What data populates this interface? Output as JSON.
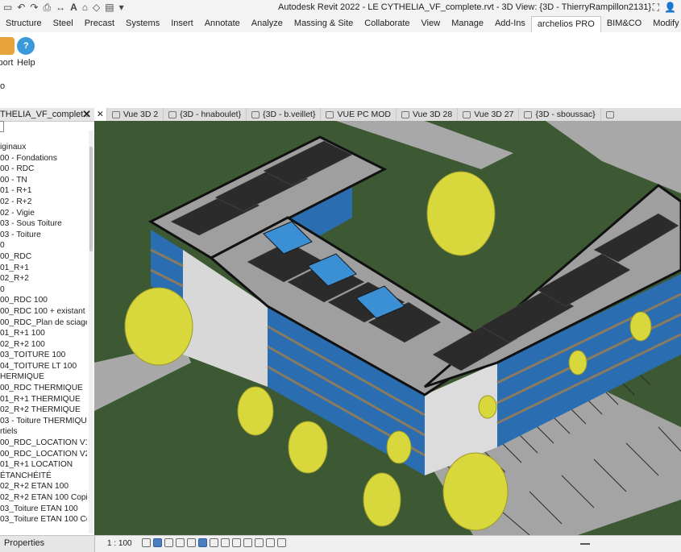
{
  "window": {
    "title": "Autodesk Revit 2022 - LE CYTHELIA_VF_complete.rvt - 3D View: {3D - ThierryRampillon2131}",
    "qat_icons": [
      "open-icon",
      "undo-icon",
      "redo-icon",
      "print-icon",
      "measure-icon",
      "text-icon",
      "3d-icon",
      "section-icon",
      "switch-windows-icon",
      "dropdown-icon"
    ]
  },
  "ribbon_tabs": [
    "Structure",
    "Steel",
    "Precast",
    "Systems",
    "Insert",
    "Annotate",
    "Analyze",
    "Massing & Site",
    "Collaborate",
    "View",
    "Manage",
    "Add-Ins",
    "archelios PRO",
    "BIM&CO",
    "Modify"
  ],
  "active_tab": "archelios PRO",
  "ribbon": {
    "export_label": "port",
    "help_label": "Help",
    "panel_label": "o"
  },
  "browser": {
    "title": "THELIA_VF_complet...",
    "items": [
      "iginaux",
      "00 - Fondations",
      "00 - RDC",
      "00 - TN",
      "01 - R+1",
      "02 - R+2",
      "02 - Vigie",
      "03 - Sous Toiture",
      "03 - Toiture",
      "0",
      "00_RDC",
      "01_R+1",
      "02_R+2",
      "0",
      "00_RDC 100",
      "00_RDC 100 + existant",
      "00_RDC_Plan de sciage",
      "01_R+1 100",
      "02_R+2 100",
      "03_TOITURE 100",
      "04_TOITURE LT 100",
      "HERMIQUE",
      "00_RDC THERMIQUE",
      "01_R+1 THERMIQUE",
      "02_R+2 THERMIQUE",
      "03 - Toiture THERMIQU",
      "rtiels",
      "00_RDC_LOCATION V1",
      "00_RDC_LOCATION V2",
      "01_R+1 LOCATION",
      "ÉTANCHÉITÉ",
      "02_R+2 ETAN 100",
      "02_R+2 ETAN 100 Copi",
      "03_Toiture ETAN 100",
      "03_Toiture ETAN 100 Co"
    ]
  },
  "view_tabs": [
    "Vue 3D 2",
    "{3D - hnaboulet}",
    "{3D - b.veillet}",
    "VUE PC MOD",
    "Vue 3D 28",
    "Vue 3D 27",
    "{3D - sboussac}"
  ],
  "status": {
    "properties_label": "Properties",
    "scale": "1 : 100"
  },
  "colors": {
    "ground": "#3d5934",
    "roof": "#9f9f9f",
    "solar_panel": "#2b2b2b",
    "glazing": "#1f6fb5",
    "tree": "#d8d83c",
    "road": "#a4a4a4",
    "wall": "#d9d9d9"
  }
}
